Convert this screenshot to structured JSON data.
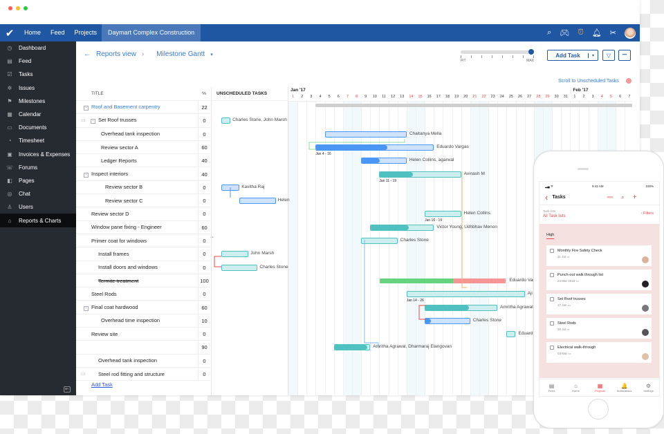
{
  "window": {
    "dot_colors": [
      "#ff5f57",
      "#febc2e",
      "#28c840"
    ]
  },
  "topbar": {
    "nav": [
      "Home",
      "Feed",
      "Projects"
    ],
    "active_project": "Daymart Complex Construction",
    "icons": [
      "search-icon",
      "gamepad-icon",
      "alarm-clock-icon",
      "bell-icon",
      "tools-icon",
      "user-avatar"
    ],
    "brand_color": "#1f57a3"
  },
  "sidebar": {
    "items": [
      {
        "label": "Dashboard",
        "icon": "◷"
      },
      {
        "label": "Feed",
        "icon": "▤"
      },
      {
        "label": "Tasks",
        "icon": "☑"
      },
      {
        "label": "Issues",
        "icon": "✲"
      },
      {
        "label": "Milestones",
        "icon": "⚑"
      },
      {
        "label": "Calendar",
        "icon": "▦"
      },
      {
        "label": "Documents",
        "icon": "▭"
      },
      {
        "label": "Timesheet",
        "icon": "◔"
      },
      {
        "label": "Invoices & Expenses",
        "icon": "▣"
      },
      {
        "label": "Forums",
        "icon": "☏"
      },
      {
        "label": "Pages",
        "icon": "◧"
      },
      {
        "label": "Chat",
        "icon": "◎"
      },
      {
        "label": "Users",
        "icon": "♙"
      },
      {
        "label": "Reports & Charts",
        "icon": "⌂",
        "active": true
      }
    ]
  },
  "breadcrumb": {
    "back": "←",
    "reports": "Reports view",
    "sep": "›",
    "current": "Milestone Gantt",
    "caret": "▾"
  },
  "toolbar": {
    "zoom_min": "FIT",
    "zoom_max": "MAX",
    "zoom_level": 1.0,
    "add_task": "Add Task",
    "caret": "▾",
    "filter": "▽",
    "more": "•••",
    "scroll_unscheduled": "Scroll to Unscheduled Tasks"
  },
  "tasklist": {
    "title_header": "TITLE",
    "pct_header": "%",
    "add_task": "Add Task",
    "rows": [
      {
        "title": "Roof and Basement carpentry",
        "pct": "22",
        "level": 0,
        "collapse": true,
        "link": true
      },
      {
        "title": "Set Roof trusses",
        "pct": "0",
        "level": 1,
        "collapse": true,
        "comment": true
      },
      {
        "title": "Overhead tank inspection",
        "pct": "0",
        "level": 2
      },
      {
        "title": "Review sector A",
        "pct": "60",
        "level": 2
      },
      {
        "title": "Ledger Reports",
        "pct": "40",
        "level": 2
      },
      {
        "title": "Inspect interiors",
        "pct": "40",
        "level": 0,
        "collapse": true
      },
      {
        "title": "Review sector B",
        "pct": "0",
        "level": 3
      },
      {
        "title": "Review sector C",
        "pct": "0",
        "level": 3
      },
      {
        "title": "Review sector D",
        "pct": "0",
        "level": 0
      },
      {
        "title": "Window pane fixing - Engineer",
        "pct": "60",
        "level": 0
      },
      {
        "title": "Primer coat for windows",
        "pct": "0",
        "level": 0
      },
      {
        "title": "Install frames",
        "pct": "0",
        "level": 1
      },
      {
        "title": "Install doors and windows",
        "pct": "0",
        "level": 1
      },
      {
        "title": "Termite treatment",
        "pct": "100",
        "level": 1,
        "strike": true
      },
      {
        "title": "Steel Rods",
        "pct": "0",
        "level": 0
      },
      {
        "title": "Final coat hardwood",
        "pct": "60",
        "level": 0,
        "collapse": true
      },
      {
        "title": "Overhead time inspection",
        "pct": "10",
        "level": 2
      },
      {
        "title": "Review site",
        "pct": "0",
        "level": 0
      },
      {
        "title": "",
        "pct": "90",
        "level": 0
      },
      {
        "title": "Overhead tank inspection",
        "pct": "0",
        "level": 1
      },
      {
        "title": "Steel rod fitting and structure",
        "pct": "0",
        "level": 1,
        "comment": true
      }
    ]
  },
  "gantt": {
    "unscheduled_header": "UNSCHEDULED TASKS",
    "months": [
      {
        "label": "Jan '17",
        "start": 1
      },
      {
        "label": "Feb '17",
        "start": 32
      }
    ],
    "days": [
      "1",
      "2",
      "3",
      "4",
      "5",
      "6",
      "7",
      "8",
      "9",
      "10",
      "11",
      "12",
      "13",
      "14",
      "15",
      "16",
      "17",
      "18",
      "19",
      "20",
      "21",
      "22",
      "23",
      "24",
      "25",
      "26",
      "27",
      "28",
      "29",
      "30",
      "31",
      "1",
      "2",
      "3",
      "4",
      "5",
      "6",
      "7"
    ],
    "weekends": [
      1,
      7,
      8,
      14,
      15,
      21,
      22,
      28,
      29,
      35,
      36
    ],
    "colors": {
      "blue": "#4a97f5",
      "blue_light": "#cfe2fd",
      "teal": "#4fc1c0",
      "teal_light": "#cdeeee",
      "green": "#66d47e",
      "red": "#f79494",
      "summary": "#cfcfcf"
    },
    "bars": [
      {
        "row": 0,
        "start": 4,
        "end": 38,
        "type": "summary"
      },
      {
        "row": 1,
        "unscheduled": true,
        "uwidth": 1,
        "color": "teal",
        "label": "Charles Stone, John Marsh"
      },
      {
        "row": 2,
        "start": 5,
        "end": 13,
        "progress": 0,
        "color": "blue",
        "label": "Chaitanya Mella"
      },
      {
        "row": 3,
        "start": 4,
        "end": 16,
        "progress": 0.6,
        "color": "blue",
        "label": "Eduardo Vargas",
        "dates": "Jan 4 - 16"
      },
      {
        "row": 4,
        "start": 9,
        "end": 13,
        "progress": 0.4,
        "color": "blue",
        "label": "Helen Collins, agarwal"
      },
      {
        "row": 5,
        "start": 11,
        "end": 19,
        "progress": 0.4,
        "color": "teal",
        "label": "Avinash M",
        "dates": "Jan 11 - 19"
      },
      {
        "row": 6,
        "unscheduled": true,
        "uwidth": 2,
        "color": "blue",
        "label": "Kavitha Raj"
      },
      {
        "row": 7,
        "unscheduled": true,
        "uwidth": 4,
        "uoffset": 2,
        "color": "blue",
        "label": "Helen"
      },
      {
        "row": 8,
        "start": 16,
        "end": 19,
        "progress": 0,
        "color": "teal",
        "label": "Helen Collins",
        "dates": "Jan 16 - 19"
      },
      {
        "row": 9,
        "start": 10,
        "end": 16,
        "progress": 0.6,
        "color": "teal",
        "label": "Victor Young, Udhbhav Menon"
      },
      {
        "row": 10,
        "start": 9,
        "end": 12,
        "progress": 0,
        "color": "teal",
        "label": "Charles Stone"
      },
      {
        "row": 11,
        "unscheduled": true,
        "uwidth": 3,
        "color": "teal",
        "label": "John Marsh"
      },
      {
        "row": 12,
        "unscheduled": true,
        "uwidth": 4,
        "color": "teal",
        "label": "Charles Stone"
      },
      {
        "row": 13,
        "start": 11,
        "end": 24,
        "split": 18,
        "color": "done",
        "label": "Eduardo Varg"
      },
      {
        "row": 14,
        "start": 14,
        "end": 26,
        "progress": 0,
        "color": "teal",
        "label": "Aji",
        "dates": "Jan 14 - 26"
      },
      {
        "row": 15,
        "start": 16,
        "end": 23,
        "progress": 0.6,
        "color": "teal",
        "label": "Amritha Agrawal,"
      },
      {
        "row": 16,
        "start": 16,
        "end": 20,
        "progress": 0.1,
        "color": "blue",
        "label": "Charles Stone"
      },
      {
        "row": 17,
        "start": 25,
        "end": 25,
        "progress": 0,
        "color": "teal",
        "label": "Eduard"
      },
      {
        "row": 18,
        "start": 6,
        "end": 9,
        "progress": 0.9,
        "color": "teal",
        "label": "Amritha Agrawal, Dharmaraj Elangovan"
      }
    ]
  },
  "phone": {
    "time": "9:41 AM",
    "battery": "100%",
    "title": "Tasks",
    "back": "‹",
    "task_lists_label": "Task lists",
    "task_lists_value": "All Task lists",
    "filters": "Filters",
    "section": "High",
    "accent": "#e84545",
    "tasks": [
      {
        "title": "Monthly Fire Safety Check",
        "date": "31 Jul"
      },
      {
        "title": "Punch-out walk through list",
        "date": "23 Mar 2018"
      },
      {
        "title": "Set Roof trusses",
        "date": "17 Jan"
      },
      {
        "title": "Steel Rods",
        "date": "28 Jul"
      },
      {
        "title": "Electrical walk-through",
        "date": "03 Mar"
      }
    ],
    "tabs": [
      {
        "label": "Feed",
        "icon": "▤"
      },
      {
        "label": "Home",
        "icon": "⌂"
      },
      {
        "label": "Projects",
        "icon": "▦",
        "active": true
      },
      {
        "label": "Notifications",
        "icon": "🔔"
      },
      {
        "label": "Settings",
        "icon": "⚙"
      }
    ]
  }
}
